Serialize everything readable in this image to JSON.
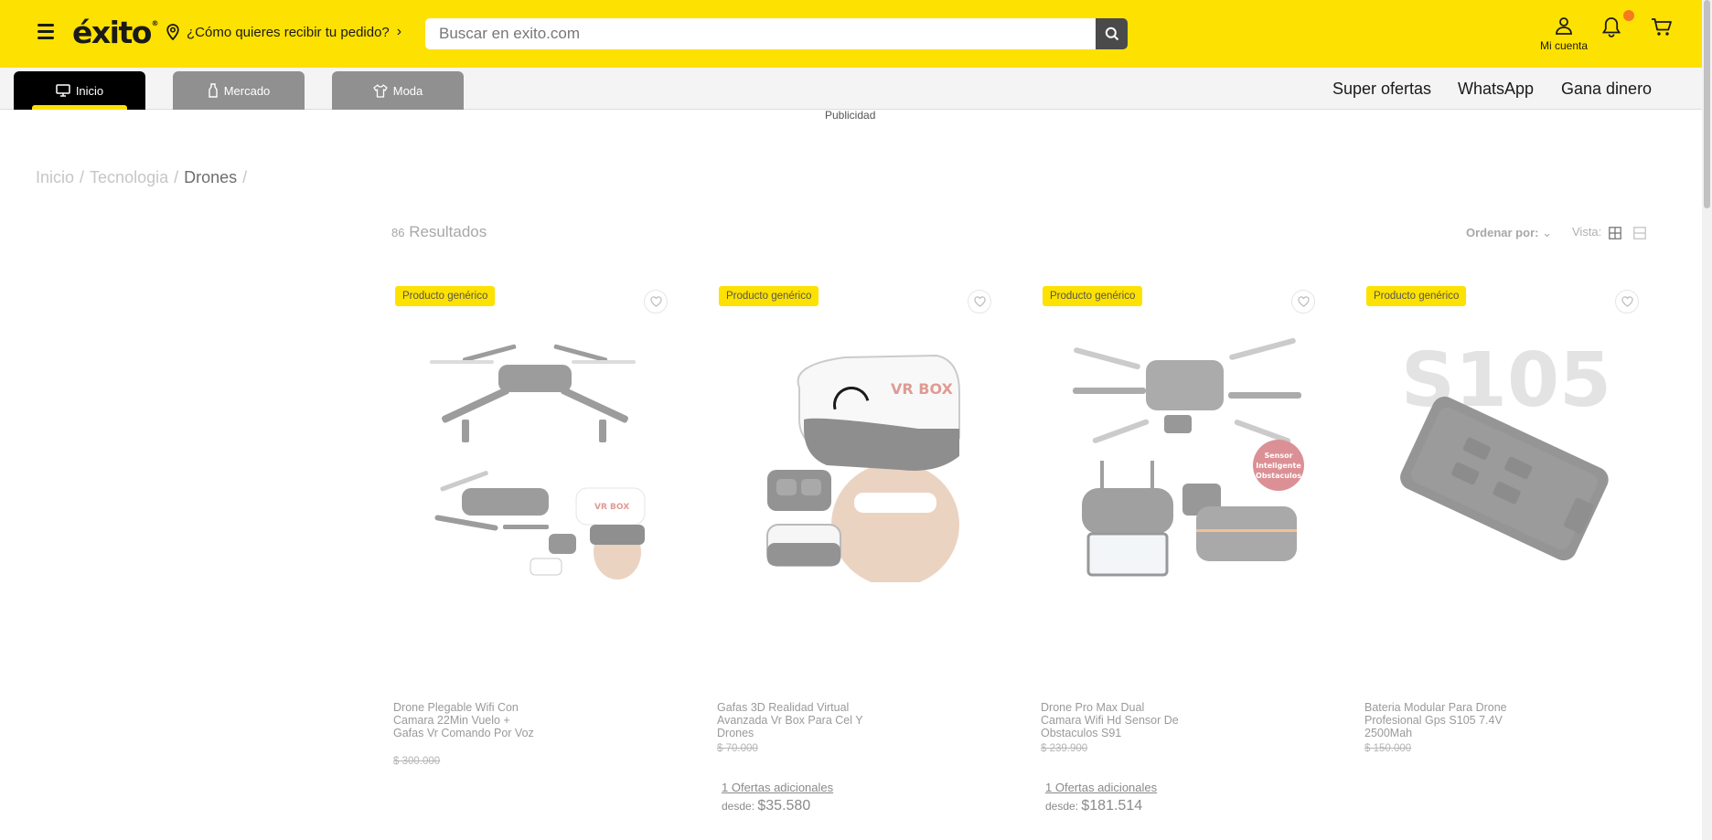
{
  "header": {
    "logo": "éxito",
    "location_prompt": "¿Cómo quieres recibir tu pedido?",
    "search_placeholder": "Buscar en exito.com",
    "account_label": "Mi cuenta",
    "brand_color": "#fde100"
  },
  "nav": {
    "tabs": [
      {
        "label": "Inicio",
        "icon": "monitor-icon",
        "active": true
      },
      {
        "label": "Mercado",
        "icon": "bottle-icon",
        "active": false
      },
      {
        "label": "Moda",
        "icon": "shirt-icon",
        "active": false
      }
    ],
    "links": [
      "Super ofertas",
      "WhatsApp",
      "Gana dinero"
    ]
  },
  "publicidad": "Publicidad",
  "breadcrumb": [
    "Inicio",
    "Tecnologia",
    "Drones"
  ],
  "results": {
    "count": "86",
    "label": "Resultados"
  },
  "sort": {
    "label": "Ordenar por:"
  },
  "view": {
    "label": "Vista:"
  },
  "products": [
    {
      "badge": "Producto genérico",
      "name": "Drone Plegable Wifi Con Camara 22Min Vuelo + Gafas Vr Comando Por Voz",
      "old_price": "$ 300.000",
      "offers": "",
      "from_label": "",
      "from_price": ""
    },
    {
      "badge": "Producto genérico",
      "name": "Gafas 3D Realidad Virtual Avanzada Vr Box Para Cel Y Drones",
      "old_price": "$ 70.000",
      "offers": "1 Ofertas adicionales",
      "from_label": "desde:",
      "from_price": "$35.580",
      "image_text": "VR BOX"
    },
    {
      "badge": "Producto genérico",
      "name": "Drone Pro Max Dual Camara Wifi Hd Sensor De Obstaculos S91",
      "old_price": "$ 239.900",
      "offers": "1 Ofertas adicionales",
      "from_label": "desde:",
      "from_price": "$181.514",
      "image_text": "Sensor Inteligente Obstaculos"
    },
    {
      "badge": "Producto genérico",
      "name": "Bateria Modular Para Drone Profesional Gps S105 7.4V 2500Mah",
      "old_price": "$ 150.000",
      "offers": "",
      "from_label": "",
      "from_price": "",
      "image_text": "S105"
    }
  ]
}
